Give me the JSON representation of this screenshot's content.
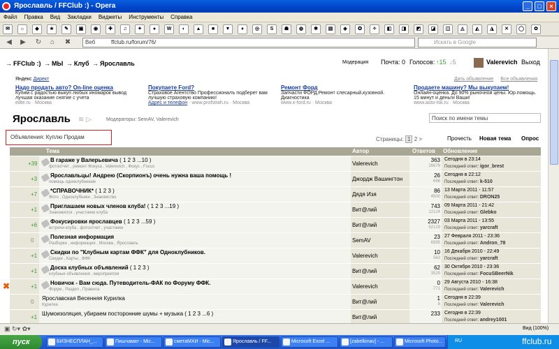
{
  "window": {
    "title": "Ярославль / FFClub :) - Opera",
    "buttons": [
      "_",
      "□",
      "×"
    ]
  },
  "menu": [
    "Файл",
    "Правка",
    "Вид",
    "Закладки",
    "Виджеты",
    "Инструменты",
    "Справка"
  ],
  "address": {
    "prefix": "Веб",
    "url": "ffclub.ru/forum/76/",
    "search_placeholder": "Искать в Google"
  },
  "breadcrumb": [
    "FFClub :)",
    "МЫ",
    "Клуб",
    "Ярославль"
  ],
  "topright": {
    "moderation": "Модерация",
    "mail": "Почта: 0",
    "votes": "Голосов:",
    "votes_up": "15",
    "votes_down": "5",
    "user": "Valerevich",
    "logout": "Выход"
  },
  "ads": {
    "brand": "Яндекс",
    "direct": "Директ",
    "right_links": [
      "Дать объявление",
      "Все объявления"
    ],
    "items": [
      {
        "title": "Надо продать авто? On-line оценка",
        "text": "Купим с радостью выкуп любых иномарок вывод лучшая оказание снятие с учета",
        "url": "edte.ru",
        "city": "Москва"
      },
      {
        "title": "Покупаете Ford?",
        "text": "Страховое Агентство Профессионалъ подберет вам лучшую страховую компанию!",
        "url": "www.profstrah.ru",
        "city": "Москва",
        "extra": "Адрес и телефон"
      },
      {
        "title": "Ремонт Форд",
        "text": "Запчасти ФОРД.Ремонт слесарный,кузовной. Диагностика",
        "url": "www.x-ford.ru",
        "city": "Москва"
      },
      {
        "title": "Продаете машину? Мы выкупаем!",
        "text": "Онлайн-оценка. До 90% рыночной цены. Юр.помощь. 15 минут и деньги Ваши!",
        "url": "www.auto-tsk.ru",
        "city": "Москва"
      }
    ]
  },
  "forum": {
    "title": "Ярославль",
    "moderators": "Модераторы: SemAV, Valerevich",
    "search_placeholder": "Поиск по имени темы",
    "classifieds": {
      "label": "Объявления:",
      "buy": "Куплю",
      "sell": "Продам"
    },
    "pages_label": "Страницы:",
    "pages": [
      "1",
      "2",
      ">"
    ],
    "actions": {
      "poll": "Прочесть",
      "new_topic": "Новая тема",
      "opros": "Опрос"
    },
    "columns": {
      "topic": "Тема",
      "author": "Автор",
      "replies": "Ответов",
      "updated": "Обновление"
    },
    "rows": [
      {
        "score": "+39",
        "title": "В гараже у Валерьевича",
        "pages": "( 1 2 3 ...10 )",
        "tags": "фотоотчет , ремонт Фокуса , Valerevich , Фокус , Focus",
        "author": "Valerevich",
        "replies": "363",
        "views": "26676",
        "date": "Сегодня в 23:14",
        "last_label": "Последний ответ:",
        "last": "igor_brest"
      },
      {
        "score": "+3",
        "title": "Ярославльцы! Андрею (Скорпионъ) очень нужна ваша помощь !",
        "pages": "",
        "tags": "помощь одноклубникам",
        "author": "Джордж Вашингтон",
        "replies": "26",
        "views": "696",
        "date": "Сегодня в 22:12",
        "last_label": "Последний ответ:",
        "last": "k-510"
      },
      {
        "score": "+7",
        "title": "*СПРАВОЧНИК*",
        "pages": "( 1 2 3 )",
        "tags": "Фото , Одноклубники , Знакомство",
        "author": "Дядя Изя",
        "replies": "86",
        "views": "4500",
        "date": "13 Марта 2011 - 11:57",
        "last_label": "Последний ответ:",
        "last": "DRON25"
      },
      {
        "score": "+1",
        "title": "Приглашаем новых членов клуба!",
        "pages": "( 1 2 3 ...19 )",
        "tags": "Знакомился , участники клуба",
        "author": "Вит@лий",
        "replies": "743",
        "views": "12124",
        "date": "09 Марта 2011 - 21:42",
        "last_label": "Последний ответ:",
        "last": "Glebko"
      },
      {
        "score": "+6",
        "title": "Фокусировки ярославцев",
        "pages": "( 1 2 3 ...59 )",
        "tags": "встречи клуба , фотоотчет , участники",
        "author": "Вит@лий",
        "replies": "2327",
        "views": "52129",
        "date": "03 Марта 2011 - 13:55",
        "last_label": "Последний ответ:",
        "last": "yarcraft"
      },
      {
        "score": "0",
        "title": "Полезная информация",
        "pages": "",
        "tags": "Разборки , информация , Москва , Ярославль",
        "author": "SemAV",
        "replies": "23",
        "views": "6995",
        "date": "27 Февраля 2011 - 23:36",
        "last_label": "Последний ответ:",
        "last": "Andron_78"
      },
      {
        "score": "+1",
        "title": "Скидки по \"Клубным картам ФФК\" для Одноклубников.",
        "pages": "",
        "tags": "Скидки , Карты , ФФК",
        "author": "Valerevich",
        "replies": "10",
        "views": "563",
        "date": "16 Декабря 2010 - 22:49",
        "last_label": "Последний ответ:",
        "last": "yarcraft"
      },
      {
        "score": "+1",
        "title": "Доска клубных объявлений",
        "pages": "( 1 2 3 )",
        "tags": "клубные объявления , мероприятия",
        "author": "Вит@лий",
        "replies": "62",
        "views": "3525",
        "date": "30 Октября 2010 - 23:36",
        "last_label": "Последний ответ:",
        "last": "FocuSBeerNik"
      },
      {
        "score": "+1",
        "title": "Новичок - Вам сюда. Путеводитель-ФАК по Форуму ФФК.",
        "pages": "",
        "tags": "Форум , Раздел , Правила",
        "author": "Valerevich",
        "replies": "0",
        "views": "771",
        "date": "29 Августа 2010 - 16:38",
        "last_label": "Последний ответ:",
        "last": "Valerevich",
        "flag": true
      },
      {
        "score": "0",
        "title": "Ярославская Весенняя Курилка",
        "pages": "",
        "tags": "Курилка",
        "author": "Вит@лий",
        "replies": "1",
        "views": "8",
        "date": "Сегодня в 22:39",
        "last_label": "Последний ответ:",
        "last": "Valerevich",
        "plain": true
      },
      {
        "score": "+1",
        "title": "Шумоизоляция, убираем посторонние шумы + музыка",
        "pages": "( 1 2 3 ...6 )",
        "tags": "",
        "author": "Вит@лий",
        "replies": "233",
        "views": "",
        "date": "Сегодня в 22:39",
        "last_label": "Последний ответ:",
        "last": "andrey1001",
        "plain": true
      }
    ]
  },
  "status": {
    "zoom": "Вид (100%)"
  },
  "taskbar": {
    "start": "пуск",
    "tasks": [
      "БИЗНЕСПЛАН_...",
      "Пишчамат - Mic...",
      "сметаМХИ - Mic...",
      "Ярославль / FF...",
      "Microsoft Excel ...",
      "[zabelkinav] - ...",
      "Microsoft Photo..."
    ],
    "lang": "RU",
    "brand": "ffclub.ru"
  }
}
